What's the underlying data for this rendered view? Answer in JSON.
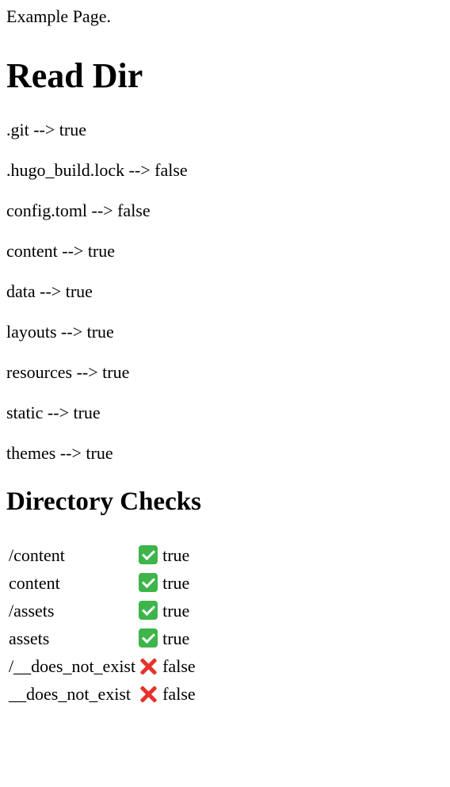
{
  "intro": "Example Page.",
  "read_dir": {
    "heading": "Read Dir",
    "entries": [
      ".git --> true",
      ".hugo_build.lock --> false",
      "config.toml --> false",
      "content --> true",
      "data --> true",
      "layouts --> true",
      "resources --> true",
      "static --> true",
      "themes --> true"
    ]
  },
  "directory_checks": {
    "heading": "Directory Checks",
    "rows": [
      {
        "path": "/content",
        "icon": "check-mark-icon",
        "result": "true"
      },
      {
        "path": "content",
        "icon": "check-mark-icon",
        "result": "true"
      },
      {
        "path": "/assets",
        "icon": "check-mark-icon",
        "result": "true"
      },
      {
        "path": "assets",
        "icon": "check-mark-icon",
        "result": "true"
      },
      {
        "path": "/__does_not_exist",
        "icon": "cross-mark-icon",
        "result": "false"
      },
      {
        "path": "__does_not_exist",
        "icon": "cross-mark-icon",
        "result": "false"
      }
    ]
  }
}
